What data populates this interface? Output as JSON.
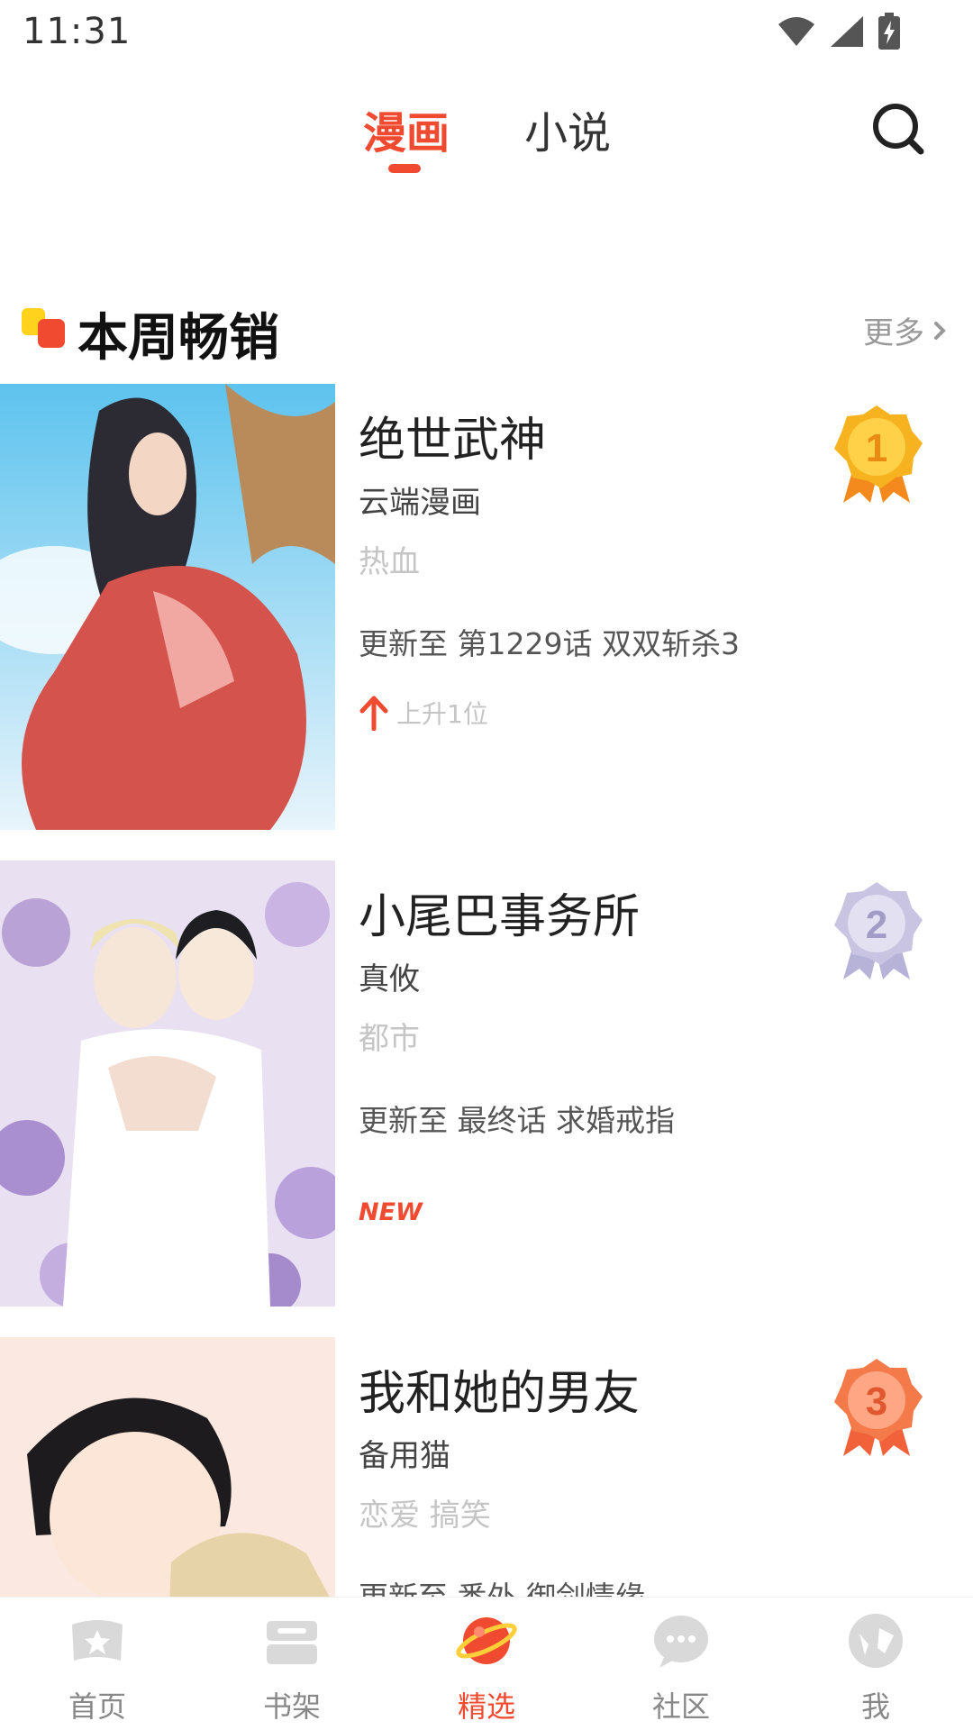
{
  "status_bar": {
    "time": "11:31",
    "icons": [
      "wifi-icon",
      "signal-icon",
      "battery-charging-icon"
    ]
  },
  "top_tabs": {
    "tabs": [
      {
        "label": "漫画",
        "active": true
      },
      {
        "label": "小说",
        "active": false
      }
    ],
    "search_icon": "search-icon"
  },
  "section": {
    "title": "本周畅销",
    "more_label": "更多"
  },
  "comics": [
    {
      "rank": "1",
      "title": "绝世武神",
      "author": "云端漫画",
      "tags": "热血",
      "update": "更新至 第1229话 双双斩杀3",
      "rank_change": "上升1位",
      "medal_color": "gold"
    },
    {
      "rank": "2",
      "title": "小尾巴事务所",
      "author": "真攸",
      "tags": "都市",
      "update": "更新至 最终话 求婚戒指",
      "badge": "NEW",
      "medal_color": "silver"
    },
    {
      "rank": "3",
      "title": "我和她的男友",
      "author": "备用猫",
      "tags": "恋爱 搞笑",
      "update": "更新至 番外 御剑情缘",
      "medal_color": "bronze"
    }
  ],
  "bottom_nav": {
    "items": [
      {
        "label": "首页",
        "icon": "home-star-icon",
        "active": false
      },
      {
        "label": "书架",
        "icon": "bookshelf-icon",
        "active": false
      },
      {
        "label": "精选",
        "icon": "planet-icon",
        "active": true
      },
      {
        "label": "社区",
        "icon": "chat-bubble-icon",
        "active": false
      },
      {
        "label": "我",
        "icon": "profile-icon",
        "active": false
      }
    ]
  },
  "colors": {
    "accent": "#f04a31",
    "gold": "#f6b21f",
    "silver": "#c8c4e2",
    "bronze": "#f57a4a"
  }
}
